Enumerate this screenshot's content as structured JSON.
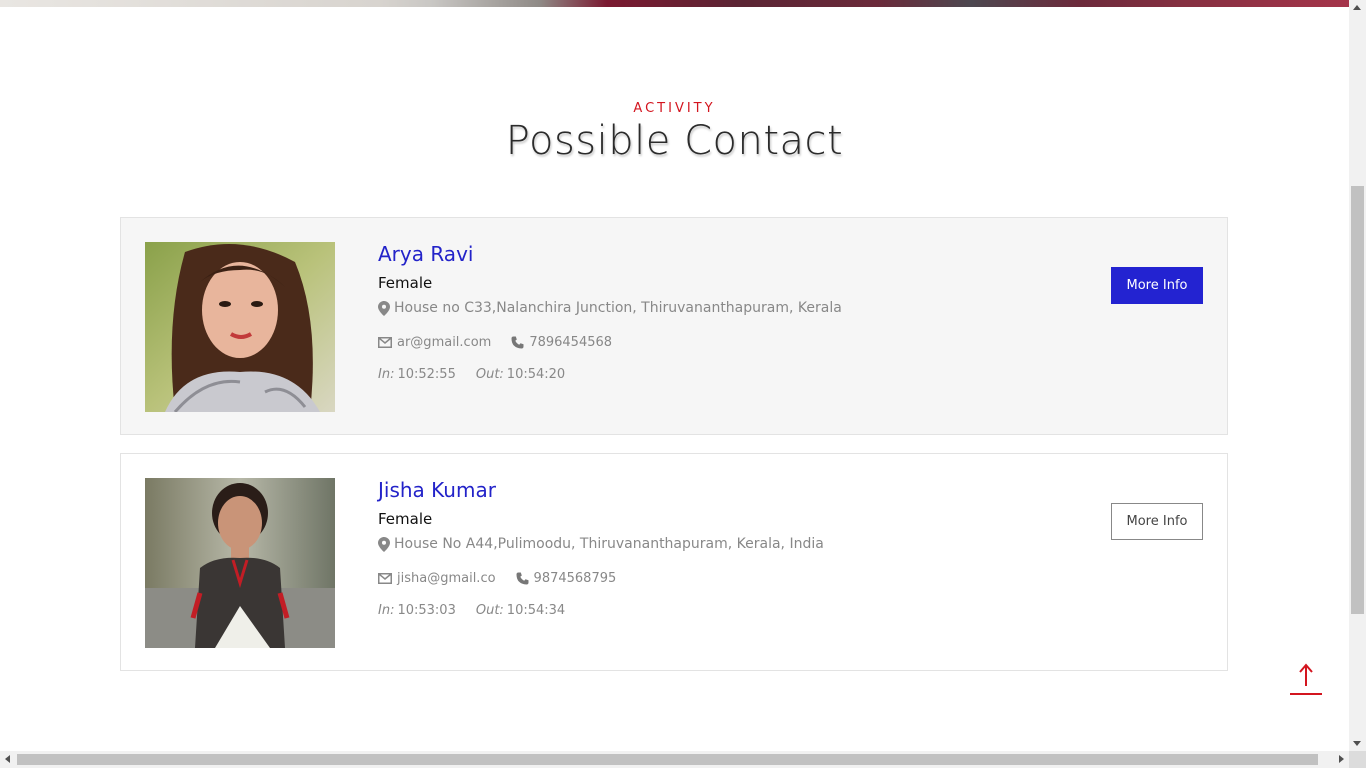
{
  "section": {
    "kicker": "ACTIVITY",
    "title": "Possible Contact"
  },
  "contacts": [
    {
      "name": "Arya Ravi",
      "gender": "Female",
      "address": "House no C33,Nalanchira Junction, Thiruvananthapuram, Kerala",
      "email": "ar@gmail.com",
      "phone": "7896454568",
      "in_label": "In:",
      "in_time": "10:52:55",
      "out_label": "Out:",
      "out_time": "10:54:20",
      "button_label": "More Info"
    },
    {
      "name": "Jisha Kumar",
      "gender": "Female",
      "address": "House No A44,Pulimoodu, Thiruvananthapuram, Kerala, India",
      "email": "jisha@gmail.co",
      "phone": "9874568795",
      "in_label": "In:",
      "in_time": "10:53:03",
      "out_label": "Out:",
      "out_time": "10:54:34",
      "button_label": "More Info"
    }
  ],
  "icons": {
    "location": "map-marker-icon",
    "email": "envelope-icon",
    "phone": "phone-icon",
    "back_to_top": "arrow-up-icon"
  },
  "colors": {
    "accent_red": "#d3151f",
    "name_blue": "#2323c9",
    "button_blue": "#2323d1"
  }
}
